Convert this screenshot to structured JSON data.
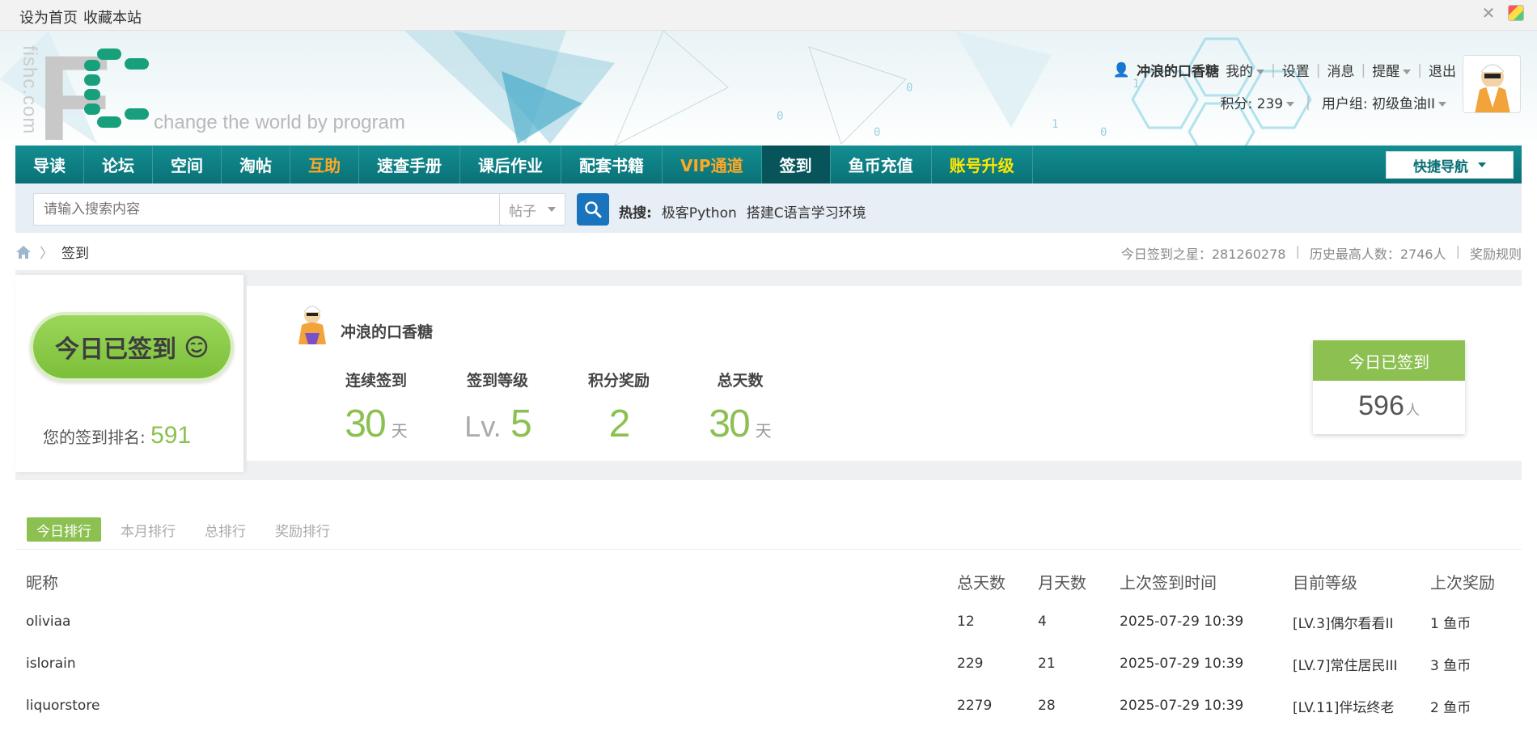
{
  "topbar": {
    "set_home": "设为首页",
    "bookmark": "收藏本站"
  },
  "header": {
    "logo_vertical": "fishc.com",
    "logo_letter": "F",
    "slogan": "change the world by program",
    "brand_color": "#0a7176",
    "user": {
      "name": "冲浪的口香糖",
      "mine": "我的",
      "settings": "设置",
      "messages": "消息",
      "remind": "提醒",
      "logout": "退出",
      "points": "积分: 239",
      "group": "用户组: 初级鱼油II"
    }
  },
  "nav": {
    "items": [
      {
        "label": "导读",
        "style": "normal"
      },
      {
        "label": "论坛",
        "style": "normal"
      },
      {
        "label": "空间",
        "style": "normal"
      },
      {
        "label": "淘帖",
        "style": "normal"
      },
      {
        "label": "互助",
        "style": "orange"
      },
      {
        "label": "速查手册",
        "style": "normal"
      },
      {
        "label": "课后作业",
        "style": "normal"
      },
      {
        "label": "配套书籍",
        "style": "normal"
      },
      {
        "label": "VIP通道",
        "style": "orange"
      },
      {
        "label": "签到",
        "style": "active"
      },
      {
        "label": "鱼币充值",
        "style": "normal"
      },
      {
        "label": "账号升级",
        "style": "yellow"
      }
    ],
    "quick_nav": "快捷导航"
  },
  "search": {
    "placeholder": "请输入搜索内容",
    "type": "帖子",
    "hot_label": "热搜:",
    "hot_items": [
      "极客Python",
      "搭建C语言学习环境"
    ]
  },
  "breadcrumb": {
    "current": "签到"
  },
  "stats": {
    "star": "今日签到之星：281260278",
    "max": "历史最高人数：2746人",
    "rules": "奖励规则"
  },
  "sign": {
    "button": "今日已签到",
    "rank_label": "您的签到排名:",
    "rank_value": "591",
    "user_name": "冲浪的口香糖",
    "columns": [
      {
        "title": "连续签到",
        "prefix": "",
        "value": "30",
        "unit": "天"
      },
      {
        "title": "签到等级",
        "prefix": "Lv.",
        "value": "5",
        "unit": ""
      },
      {
        "title": "积分奖励",
        "prefix": "",
        "value": "2",
        "unit": ""
      },
      {
        "title": "总天数",
        "prefix": "",
        "value": "30",
        "unit": "天"
      }
    ],
    "today_title": "今日已签到",
    "today_count": "596",
    "today_unit": "人",
    "accent_color": "#8cc152"
  },
  "tabs": [
    "今日排行",
    "本月排行",
    "总排行",
    "奖励排行"
  ],
  "table": {
    "headers": [
      "昵称",
      "总天数",
      "月天数",
      "上次签到时间",
      "目前等级",
      "上次奖励"
    ],
    "rows": [
      [
        "oliviaa",
        "12",
        "4",
        "2025-07-29 10:39",
        "[LV.3]偶尔看看II",
        "1 鱼币"
      ],
      [
        "islorain",
        "229",
        "21",
        "2025-07-29 10:39",
        "[LV.7]常住居民III",
        "3 鱼币"
      ],
      [
        "liquorstore",
        "2279",
        "28",
        "2025-07-29 10:39",
        "[LV.11]伴坛终老",
        "2 鱼币"
      ]
    ]
  }
}
